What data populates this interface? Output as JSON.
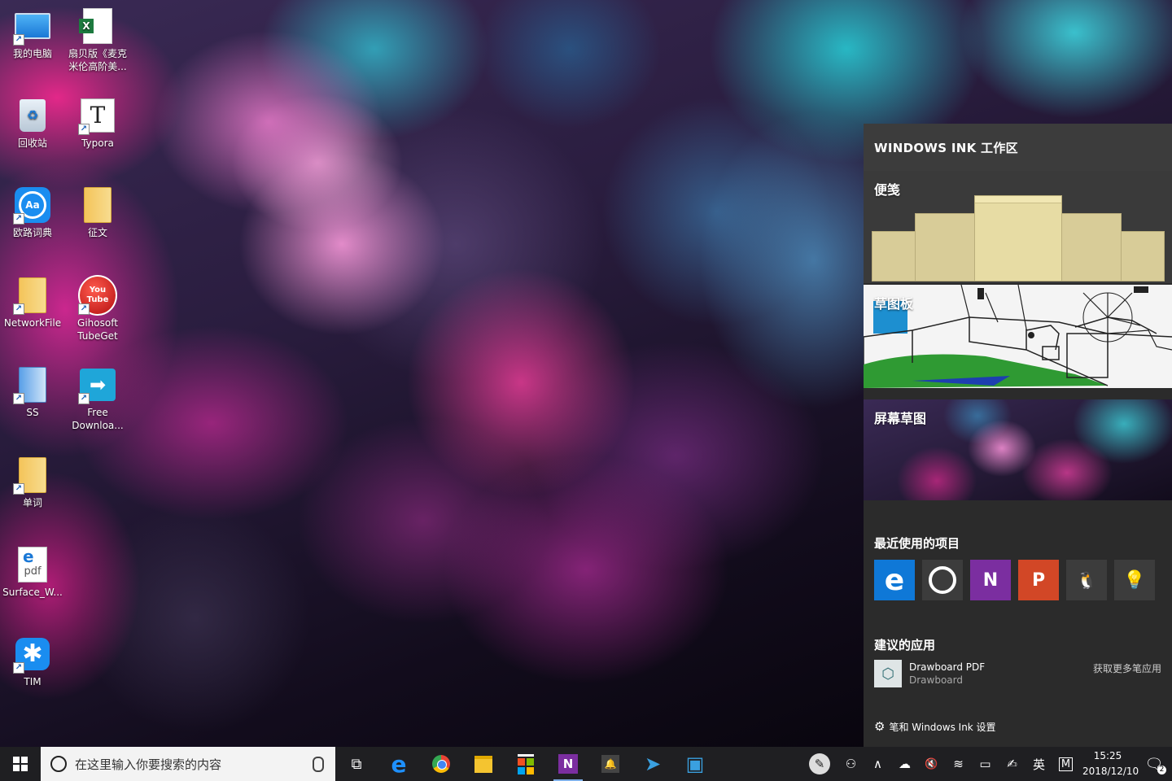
{
  "desktop": {
    "icons": [
      {
        "label_line1": "我的电脑",
        "label_line2": "",
        "icon": "computer-icon"
      },
      {
        "label_line1": "扇贝版《麦克",
        "label_line2": "米伦高阶美...",
        "icon": "excel-file-icon"
      },
      {
        "label_line1": "回收站",
        "label_line2": "",
        "icon": "recycle-bin-icon"
      },
      {
        "label_line1": "Typora",
        "label_line2": "",
        "icon": "typora-icon"
      },
      {
        "label_line1": "欧路词典",
        "label_line2": "",
        "icon": "eudic-dictionary-icon"
      },
      {
        "label_line1": "征文",
        "label_line2": "",
        "icon": "folder-icon"
      },
      {
        "label_line1": "NetworkFile",
        "label_line2": "",
        "icon": "folder-icon"
      },
      {
        "label_line1": "Gihosoft",
        "label_line2": "TubeGet",
        "icon": "youtube-icon"
      },
      {
        "label_line1": "SS",
        "label_line2": "",
        "icon": "folder-icon"
      },
      {
        "label_line1": "Free",
        "label_line2": "Downloa...",
        "icon": "free-download-icon"
      },
      {
        "label_line1": "单词",
        "label_line2": "",
        "icon": "folder-icon"
      },
      {
        "label_line1": "Surface_W...",
        "label_line2": "",
        "icon": "pdf-file-icon"
      },
      {
        "label_line1": "TIM",
        "label_line2": "",
        "icon": "tim-icon"
      }
    ],
    "icon_glyphs": {
      "typora": "T",
      "dict": "Aa",
      "yt_top": "You",
      "yt_bottom": "Tube",
      "free": "➡",
      "pdf": "pdf",
      "tim": "✱",
      "shortcut": "↗"
    }
  },
  "ink_workspace": {
    "title": "WINDOWS INK 工作区",
    "tiles": [
      {
        "title": "便笺"
      },
      {
        "title": "草图板"
      },
      {
        "title": "屏幕草图"
      }
    ],
    "recent_title": "最近使用的项目",
    "recent_apps": [
      {
        "name": "edge-app-icon",
        "glyph": "e",
        "color": "#0f78d7"
      },
      {
        "name": "cortana-app-icon",
        "glyph": "",
        "color": "#3c3c3c"
      },
      {
        "name": "onenote-app-icon",
        "glyph": "N",
        "color": "#7b2ea0"
      },
      {
        "name": "powerpoint-app-icon",
        "glyph": "P",
        "color": "#d24726"
      },
      {
        "name": "qq-app-icon",
        "glyph": "🐧",
        "color": "#3c3c3c"
      },
      {
        "name": "tips-app-icon",
        "glyph": "💡",
        "color": "#3c3c3c"
      }
    ],
    "suggested_title": "建议的应用",
    "suggested_app": {
      "name": "Drawboard PDF",
      "publisher": "Drawboard",
      "glyph": "⬡"
    },
    "more_link": "获取更多笔应用",
    "settings_link": "笔和 Windows Ink 设置",
    "settings_glyph": "⚙"
  },
  "taskbar": {
    "search_placeholder": "在这里输入你要搜索的内容",
    "task_view_glyph": "⧉",
    "apps": [
      {
        "name": "edge-taskbar-icon",
        "glyph": "e",
        "color": "#1e90ff"
      },
      {
        "name": "chrome-taskbar-icon",
        "glyph": "◉",
        "color": "#34a853"
      },
      {
        "name": "file-explorer-taskbar-icon",
        "glyph": "▬",
        "color": "#f4c430"
      },
      {
        "name": "store-taskbar-icon",
        "glyph": "🛍",
        "color": "#ffffff"
      },
      {
        "name": "onenote-taskbar-icon",
        "glyph": "N",
        "color": "#7b2ea0"
      },
      {
        "name": "qq-taskbar-icon",
        "glyph": "🔔",
        "color": "#ffffff"
      },
      {
        "name": "telegram-taskbar-icon",
        "glyph": "➤",
        "color": "#3aa0e0"
      },
      {
        "name": "window-taskbar-icon",
        "glyph": "▣",
        "color": "#3aa0e0"
      }
    ],
    "tray": {
      "pen_glyph": "✎",
      "people_glyph": "⚇",
      "chevron_glyph": "∧",
      "cloud_glyph": "☁",
      "volume_glyph": "🔇",
      "wifi_glyph": "≋",
      "battery_glyph": "▭",
      "ink_glyph": "✍",
      "ime_lang": "英",
      "ime_mode": "M",
      "time": "15:25",
      "date": "2018/12/10",
      "notification_glyph": "🗨",
      "notification_count": "2"
    }
  }
}
